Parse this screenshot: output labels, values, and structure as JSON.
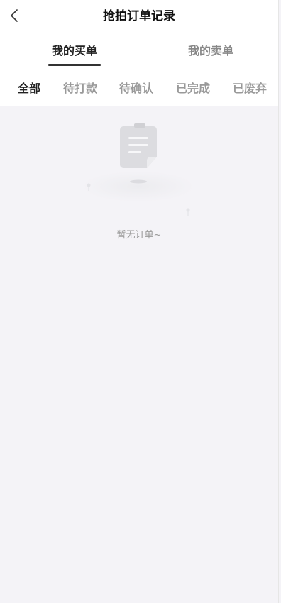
{
  "header": {
    "title": "抢拍订单记录",
    "back_icon": "chevron-left-icon"
  },
  "main_tabs": [
    {
      "label": "我的买单",
      "active": true
    },
    {
      "label": "我的卖单",
      "active": false
    }
  ],
  "filter_tabs": [
    {
      "label": "全部",
      "active": true
    },
    {
      "label": "待打款",
      "active": false
    },
    {
      "label": "待确认",
      "active": false
    },
    {
      "label": "已完成",
      "active": false
    },
    {
      "label": "已废弃",
      "active": false
    }
  ],
  "empty_state": {
    "icon": "empty-document-icon",
    "text": "暂无订单~"
  },
  "colors": {
    "background": "#f4f3f7",
    "header_background": "#ffffff",
    "active_text": "#222222",
    "inactive_text": "#999999",
    "underline": "#333333"
  }
}
